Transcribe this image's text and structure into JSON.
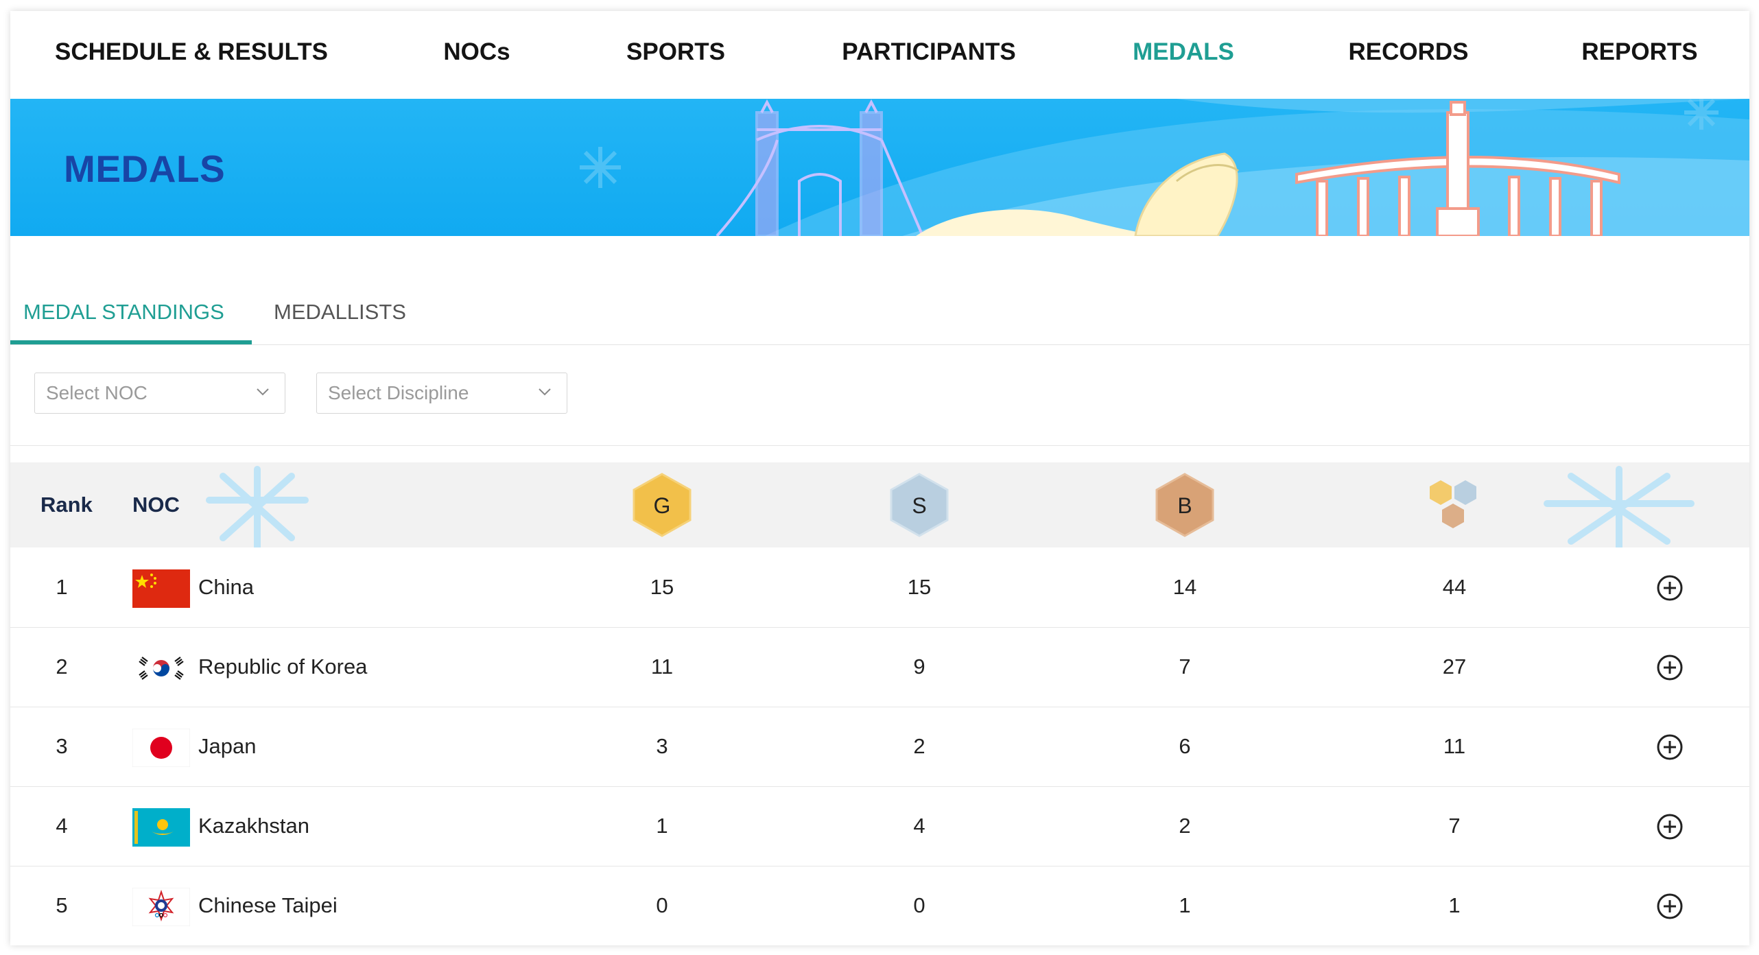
{
  "nav": [
    {
      "label": "SCHEDULE & RESULTS",
      "active": false
    },
    {
      "label": "NOCs",
      "active": false
    },
    {
      "label": "SPORTS",
      "active": false
    },
    {
      "label": "PARTICIPANTS",
      "active": false
    },
    {
      "label": "MEDALS",
      "active": true
    },
    {
      "label": "RECORDS",
      "active": false
    },
    {
      "label": "REPORTS",
      "active": false
    }
  ],
  "banner": {
    "title": "MEDALS"
  },
  "tabs": [
    {
      "label": "MEDAL STANDINGS",
      "active": true
    },
    {
      "label": "MEDALLISTS",
      "active": false
    }
  ],
  "filters": {
    "noc_placeholder": "Select NOC",
    "discipline_placeholder": "Select Discipline"
  },
  "table": {
    "headers": {
      "rank": "Rank",
      "noc": "NOC",
      "gold": "G",
      "silver": "S",
      "bronze": "B"
    },
    "rows": [
      {
        "rank": "1",
        "noc": "China",
        "gold": "15",
        "silver": "15",
        "bronze": "14",
        "total": "44",
        "flag_icon": "china-flag-icon"
      },
      {
        "rank": "2",
        "noc": "Republic of Korea",
        "gold": "11",
        "silver": "9",
        "bronze": "7",
        "total": "27",
        "flag_icon": "korea-flag-icon"
      },
      {
        "rank": "3",
        "noc": "Japan",
        "gold": "3",
        "silver": "2",
        "bronze": "6",
        "total": "11",
        "flag_icon": "japan-flag-icon"
      },
      {
        "rank": "4",
        "noc": "Kazakhstan",
        "gold": "1",
        "silver": "4",
        "bronze": "2",
        "total": "7",
        "flag_icon": "kazakhstan-flag-icon"
      },
      {
        "rank": "5",
        "noc": "Chinese Taipei",
        "gold": "0",
        "silver": "0",
        "bronze": "1",
        "total": "1",
        "flag_icon": "chinese-taipei-flag-icon"
      }
    ]
  },
  "colors": {
    "accent": "#1f9e93",
    "banner_blue": "#11aaf1",
    "banner_title": "#1845a6",
    "gold": "#f2c04a",
    "silver": "#b9cfe0",
    "bronze": "#d8a276"
  }
}
